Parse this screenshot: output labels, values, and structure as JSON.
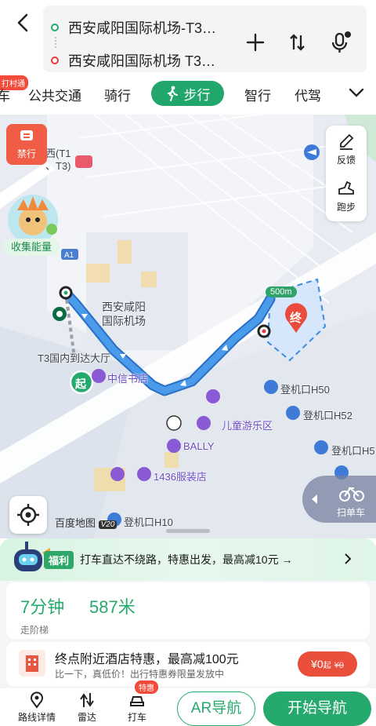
{
  "header": {
    "start": "西安咸阳国际机场-T3…",
    "end": "西安咸阳国际机场 T3…",
    "badge": "打村通"
  },
  "tabs": {
    "items": [
      "公共交通",
      "骑行",
      "步行",
      "智行",
      "代驾"
    ],
    "active": "步行",
    "partial": "车"
  },
  "map": {
    "forbid_label": "禁行",
    "energy_label": "收集能量",
    "feedback_label": "反馈",
    "run_label": "跑步",
    "distance_chip": "500m",
    "end_marker": "终",
    "start_marker": "起",
    "labels": {
      "airport": "西安咸阳\n国际机场",
      "terminal_partial": "西(T1\n、T3)",
      "t3_hall": "T3国内到达大厅",
      "citic": "中信书店",
      "kids": "儿童游乐区",
      "bally": "BALLY",
      "clothes": "1436服装店",
      "h50": "登机口H50",
      "h52": "登机口H52",
      "h5x": "登机口H5",
      "h10": "登机口H10",
      "road_a1": "A1",
      "baidu": "百度地图",
      "v20": "V20"
    },
    "scan_bike": "扫单车"
  },
  "promo": {
    "tag": "福利",
    "text": "打车直达不绕路，特惠出发，最高减10元 →"
  },
  "summary": {
    "time": "7分钟",
    "distance": "587米",
    "stairs": "走阶梯"
  },
  "hotel": {
    "title": "终点附近酒店特惠，最高减100元",
    "subtitle": "比一下，真低价！出行特惠券限量发放中",
    "price": "¥0",
    "price_suffix": "起",
    "price_old": "¥0"
  },
  "bottom_nav": {
    "detail": "路线详情",
    "switch": "雷达",
    "taxi": "打车",
    "hot_badge": "特惠",
    "ar": "AR导航",
    "start": "开始导航"
  },
  "colors": {
    "primary": "#26a96c",
    "route": "#3d8be0",
    "danger": "#e53b3b"
  }
}
